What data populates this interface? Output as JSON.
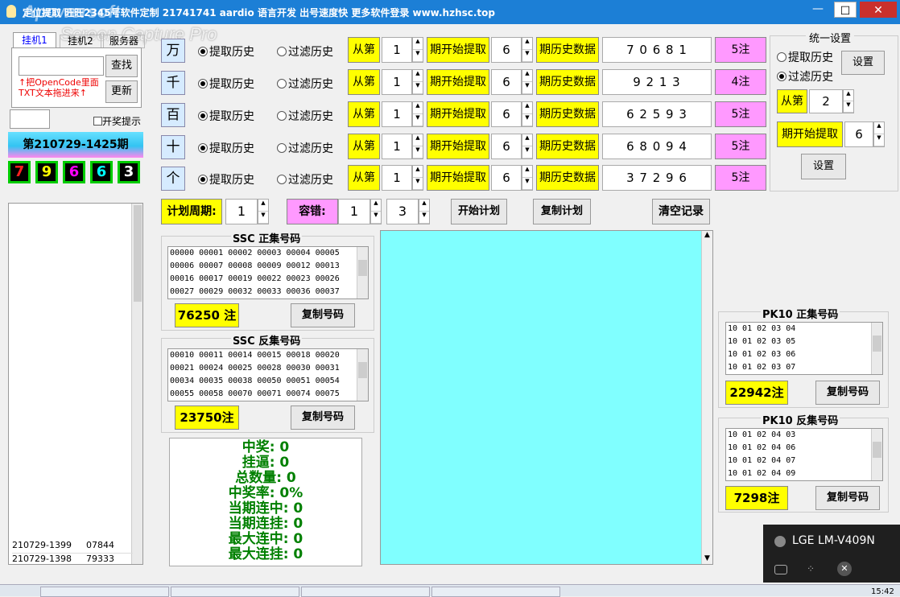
{
  "title": "定位提取 旺旺2345号软件定制 21741741  aardio 语言开发  出号速度快  更多软件登录  www.hzhsc.top",
  "watermark": [
    "Apowersoft",
    "Screen Capture Pro"
  ],
  "tabs": [
    "挂机1",
    "挂机2",
    "服务器"
  ],
  "left": {
    "search_btn": "查找",
    "update_btn": "更新",
    "hint": "↑把OpenCode里面TXT文本拖进来↑",
    "checkbox": "开奖提示",
    "period": "第210729-1425期",
    "balls": [
      "7",
      "9",
      "6",
      "6",
      "3"
    ],
    "history": [
      [
        "210729-1399",
        "07844"
      ],
      [
        "210729-1398",
        "79333"
      ]
    ]
  },
  "rows": [
    {
      "label": "万",
      "r1": "提取历史",
      "r2": "过滤历史",
      "from": "从第",
      "n1": "1",
      "start": "期开始提取",
      "n2": "6",
      "hist": "期历史数据",
      "digits": "7 0 6 8 1",
      "count": "5注"
    },
    {
      "label": "千",
      "r1": "提取历史",
      "r2": "过滤历史",
      "from": "从第",
      "n1": "1",
      "start": "期开始提取",
      "n2": "6",
      "hist": "期历史数据",
      "digits": "9 2 1 3",
      "count": "4注"
    },
    {
      "label": "百",
      "r1": "提取历史",
      "r2": "过滤历史",
      "from": "从第",
      "n1": "1",
      "start": "期开始提取",
      "n2": "6",
      "hist": "期历史数据",
      "digits": "6 2 5 9 3",
      "count": "5注"
    },
    {
      "label": "十",
      "r1": "提取历史",
      "r2": "过滤历史",
      "from": "从第",
      "n1": "1",
      "start": "期开始提取",
      "n2": "6",
      "hist": "期历史数据",
      "digits": "6 8 0 9 4",
      "count": "5注"
    },
    {
      "label": "个",
      "r1": "提取历史",
      "r2": "过滤历史",
      "from": "从第",
      "n1": "1",
      "start": "期开始提取",
      "n2": "6",
      "hist": "期历史数据",
      "digits": "3 7 2 9 6",
      "count": "5注"
    }
  ],
  "unified": {
    "title": "统一设置",
    "r1": "提取历史",
    "r2": "过滤历史",
    "set1": "设置",
    "from": "从第",
    "n1": "2",
    "start": "期开始提取",
    "n2": "6",
    "set2": "设置"
  },
  "plan": {
    "cycle_label": "计划周期:",
    "cycle": "1",
    "tol_label": "容错:",
    "tol1": "1",
    "tol2": "3",
    "start_btn": "开始计划",
    "copy_btn": "复制计划",
    "clear_btn": "清空记录"
  },
  "ssc_pos": {
    "title": "SSC 正集号码",
    "lines": [
      "00000 00001 00002 00003 00004 00005",
      "00006 00007 00008 00009 00012 00013",
      "00016 00017 00019 00022 00023 00026",
      "00027 00029 00032 00033 00036 00037"
    ],
    "count": "76250 注",
    "copy": "复制号码"
  },
  "ssc_neg": {
    "title": "SSC 反集号码",
    "lines": [
      "00010 00011 00014 00015 00018 00020",
      "00021 00024 00025 00028 00030 00031",
      "00034 00035 00038 00050 00051 00054",
      "00055 00058 00070 00071 00074 00075"
    ],
    "count": "23750注",
    "copy": "复制号码"
  },
  "stats": [
    "中奖: 0",
    "挂逼: 0",
    "总数量: 0",
    "中奖率: 0%",
    "当期连中: 0",
    "当期连挂: 0",
    "最大连中: 0",
    "最大连挂: 0"
  ],
  "pk_pos": {
    "title": "PK10 正集号码",
    "lines": [
      "10 01 02 03 04",
      "10 01 02 03 05",
      "10 01 02 03 06",
      "10 01 02 03 07"
    ],
    "count": "22942注",
    "copy": "复制号码"
  },
  "pk_neg": {
    "title": "PK10 反集号码",
    "lines": [
      "10 01 02 04 03",
      "10 01 02 04 06",
      "10 01 02 04 07",
      "10 01 02 04 09"
    ],
    "count": "7298注",
    "copy": "复制号码"
  },
  "notify": {
    "device": "LGE LM-V409N"
  },
  "clock": "15:42",
  "colors": {
    "ball_colors": [
      "#ff2020",
      "#ffff00",
      "#ff00ff",
      "#00ffff",
      "#ffffff"
    ],
    "cyan": "#80ffff"
  }
}
